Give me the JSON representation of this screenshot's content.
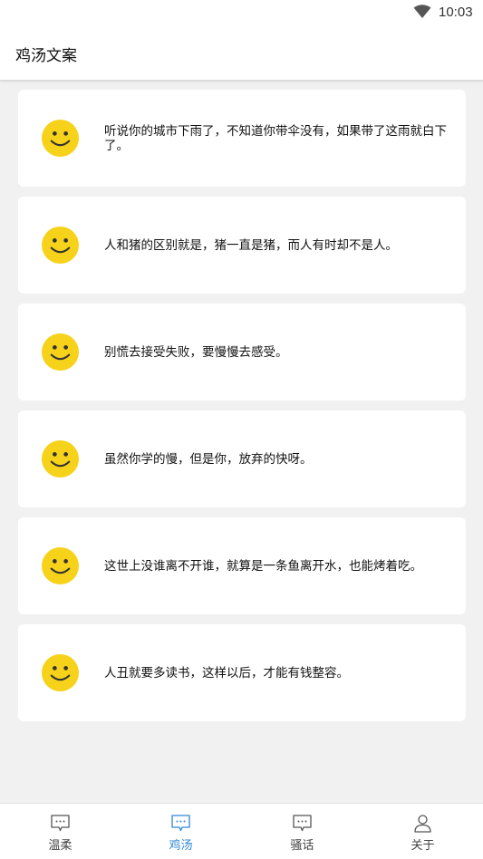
{
  "status_bar": {
    "time": "10:03",
    "wifi_icon": "wifi-icon"
  },
  "app_bar": {
    "title": "鸡汤文案"
  },
  "cards": [
    {
      "icon": "smiley-icon",
      "text": "听说你的城市下雨了，不知道你带伞没有，如果带了这雨就白下了。"
    },
    {
      "icon": "smiley-icon",
      "text": "人和猪的区别就是，猪一直是猪，而人有时却不是人。"
    },
    {
      "icon": "smiley-icon",
      "text": "别慌去接受失败，要慢慢去感受。"
    },
    {
      "icon": "smiley-icon",
      "text": "虽然你学的慢，但是你，放弃的快呀。"
    },
    {
      "icon": "smiley-icon",
      "text": "这世上没谁离不开谁，就算是一条鱼离开水，也能烤着吃。"
    },
    {
      "icon": "smiley-icon",
      "text": "人丑就要多读书，这样以后，才能有钱整容。"
    }
  ],
  "bottom_nav": {
    "active_index": 1,
    "active_color": "#2f86d6",
    "inactive_color": "#444444",
    "items": [
      {
        "label": "温柔",
        "icon": "chat-bubble-icon"
      },
      {
        "label": "鸡汤",
        "icon": "chat-bubble-icon"
      },
      {
        "label": "骚话",
        "icon": "chat-bubble-icon"
      },
      {
        "label": "关于",
        "icon": "person-icon"
      }
    ]
  },
  "colors": {
    "smiley_yellow": "#f7d21a",
    "background": "#f1f1f1",
    "card": "#ffffff"
  }
}
